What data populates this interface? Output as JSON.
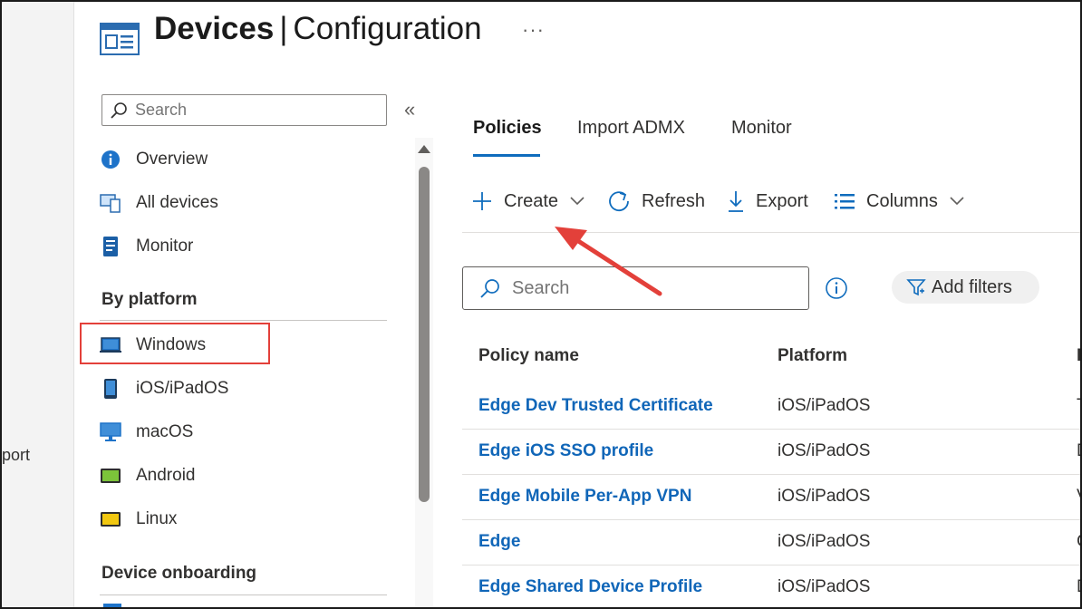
{
  "header": {
    "title_main": "Devices",
    "title_sep": "|",
    "title_sub": "Configuration",
    "more": "···"
  },
  "left_strip": {
    "partial_text": "port"
  },
  "sidebar": {
    "search_placeholder": "Search",
    "collapse": "«",
    "items": [
      {
        "label": "Overview",
        "icon": "info-icon"
      },
      {
        "label": "All devices",
        "icon": "devices-icon"
      },
      {
        "label": "Monitor",
        "icon": "monitor-notebook-icon"
      }
    ],
    "section_platform": "By platform",
    "platforms": [
      {
        "label": "Windows",
        "icon": "windows-laptop-icon"
      },
      {
        "label": "iOS/iPadOS",
        "icon": "phone-icon"
      },
      {
        "label": "macOS",
        "icon": "desktop-icon"
      },
      {
        "label": "Android",
        "icon": "android-device-icon"
      },
      {
        "label": "Linux",
        "icon": "linux-device-icon"
      }
    ],
    "section_onboarding": "Device onboarding"
  },
  "tabs": [
    {
      "label": "Policies",
      "active": true
    },
    {
      "label": "Import ADMX",
      "active": false
    },
    {
      "label": "Monitor",
      "active": false
    }
  ],
  "toolbar": {
    "create": "Create",
    "refresh": "Refresh",
    "export": "Export",
    "columns": "Columns"
  },
  "search": {
    "placeholder": "Search"
  },
  "filters": {
    "label": "Add filters"
  },
  "table": {
    "headers": [
      "Policy name",
      "Platform",
      "P"
    ],
    "rows": [
      {
        "name": "Edge Dev Trusted Certificate",
        "platform": "iOS/iPadOS",
        "extra": "T"
      },
      {
        "name": "Edge iOS SSO profile",
        "platform": "iOS/iPadOS",
        "extra": "D"
      },
      {
        "name": "Edge Mobile Per-App VPN",
        "platform": "iOS/iPadOS",
        "extra": "V"
      },
      {
        "name": "Edge",
        "platform": "iOS/iPadOS",
        "extra": "C"
      },
      {
        "name": "Edge Shared Device Profile",
        "platform": "iOS/iPadOS",
        "extra": "D"
      }
    ]
  },
  "colors": {
    "accent": "#0f6cbd",
    "link": "#1066b8",
    "highlight": "#e3403a"
  }
}
